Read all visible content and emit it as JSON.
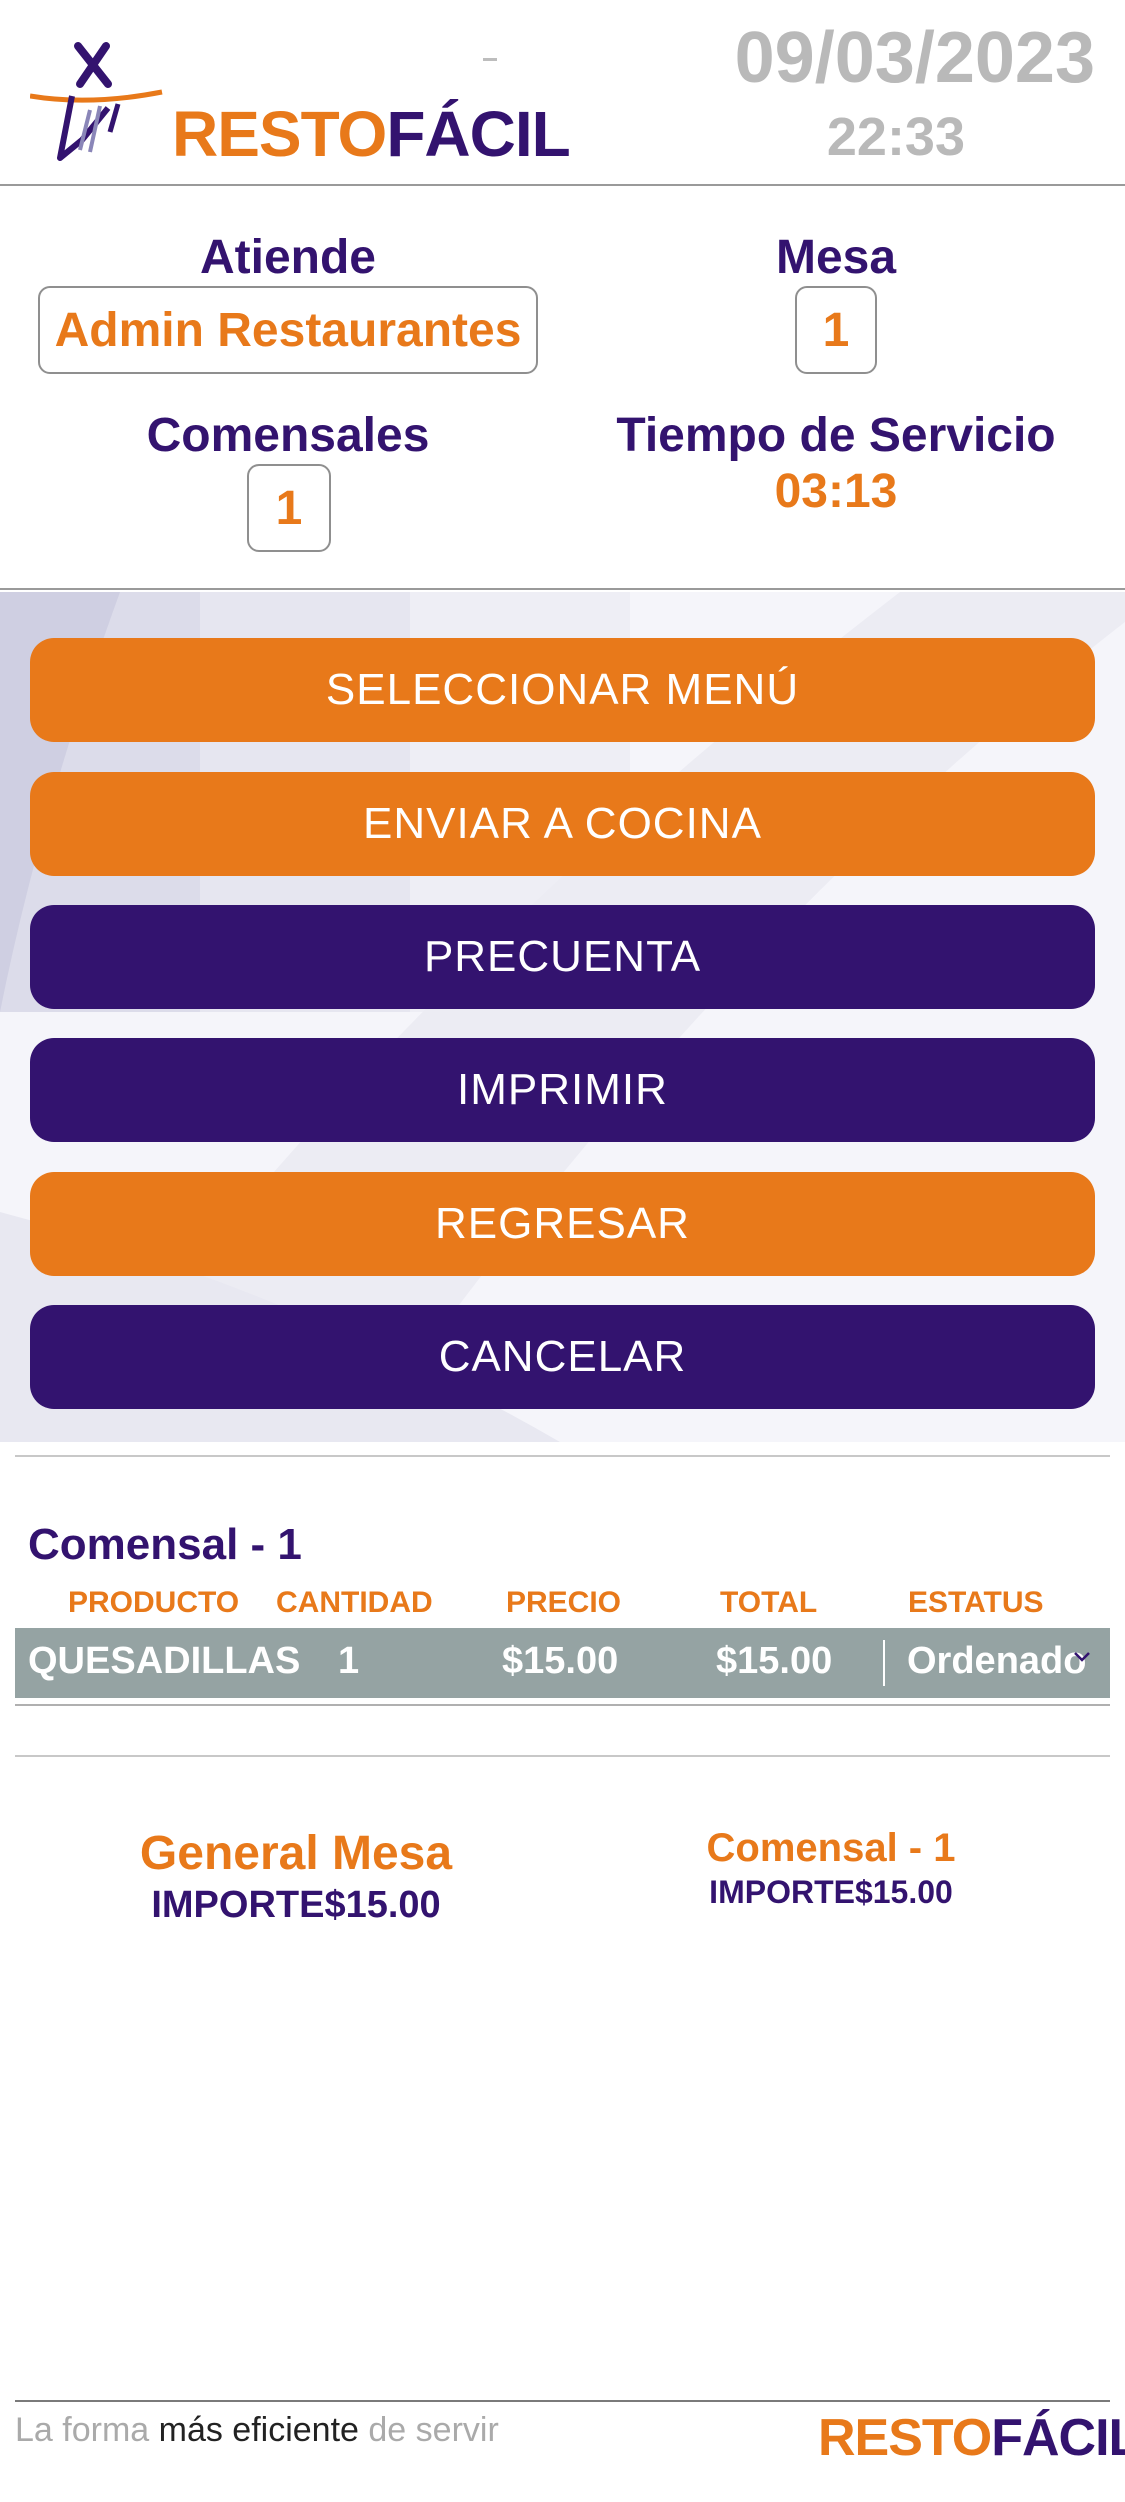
{
  "header": {
    "logo": {
      "resto": "RESTO",
      "facil": "FÁCIL"
    },
    "date": "09/03/2023",
    "time": "22:33"
  },
  "info": {
    "atiende_label": "Atiende",
    "atiende_value": "Admin Restaurantes",
    "mesa_label": "Mesa",
    "mesa_value": "1",
    "comensales_label": "Comensales",
    "comensales_value": "1",
    "tiempo_label": "Tiempo de Servicio",
    "tiempo_value": "03:13"
  },
  "buttons": {
    "seleccionar": "SELECCIONAR MENÚ",
    "enviar": "ENVIAR A COCINA",
    "precuenta": "PRECUENTA",
    "imprimir": "IMPRIMIR",
    "regresar": "REGRESAR",
    "cancelar": "CANCELAR"
  },
  "order": {
    "comensal_title": "Comensal - 1",
    "columns": [
      "PRODUCTO",
      "CANTIDAD",
      "PRECIO",
      "TOTAL",
      "ESTATUS"
    ],
    "rows": [
      {
        "producto": "QUESADILLAS",
        "cantidad": "1",
        "precio": "$15.00",
        "total": "$15.00",
        "estatus": "Ordenado"
      }
    ]
  },
  "totals": {
    "general_title": "General Mesa",
    "general_amount": "IMPORTE$15.00",
    "comensal_title": "Comensal - 1",
    "comensal_amount": "IMPORTE$15.00"
  },
  "footer": {
    "tag_1": "La forma ",
    "tag_2": "más eficiente",
    "tag_3": " de servir",
    "logo": {
      "resto": "RESTO",
      "facil": "FÁCIL"
    }
  },
  "colors": {
    "orange": "#e8791a",
    "purple": "#33136f",
    "row_gray": "#95a3a3"
  }
}
